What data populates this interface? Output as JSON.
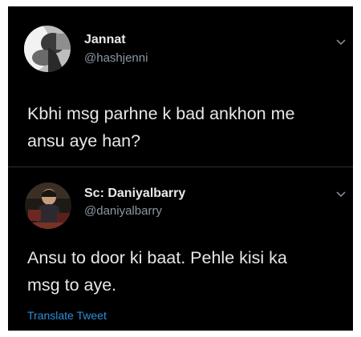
{
  "tweets": [
    {
      "name": "Jannat",
      "handle": "@hashjenni",
      "text_lines": [
        "Kbhi msg parhne k bad ankhon me",
        "ansu aye han?"
      ]
    },
    {
      "name": "Sc: Daniyalbarry",
      "handle": "@daniyalbarry",
      "text_lines": [
        "Ansu to door ki baat. Pehle kisi ka",
        "msg to aye."
      ],
      "translate_label": "Translate Tweet"
    }
  ],
  "icons": {
    "menu": "chevron-down-icon"
  },
  "colors": {
    "background": "#000000",
    "name": "#e9e9e9",
    "handle": "#8b98a5",
    "link": "#2f8fd8"
  }
}
